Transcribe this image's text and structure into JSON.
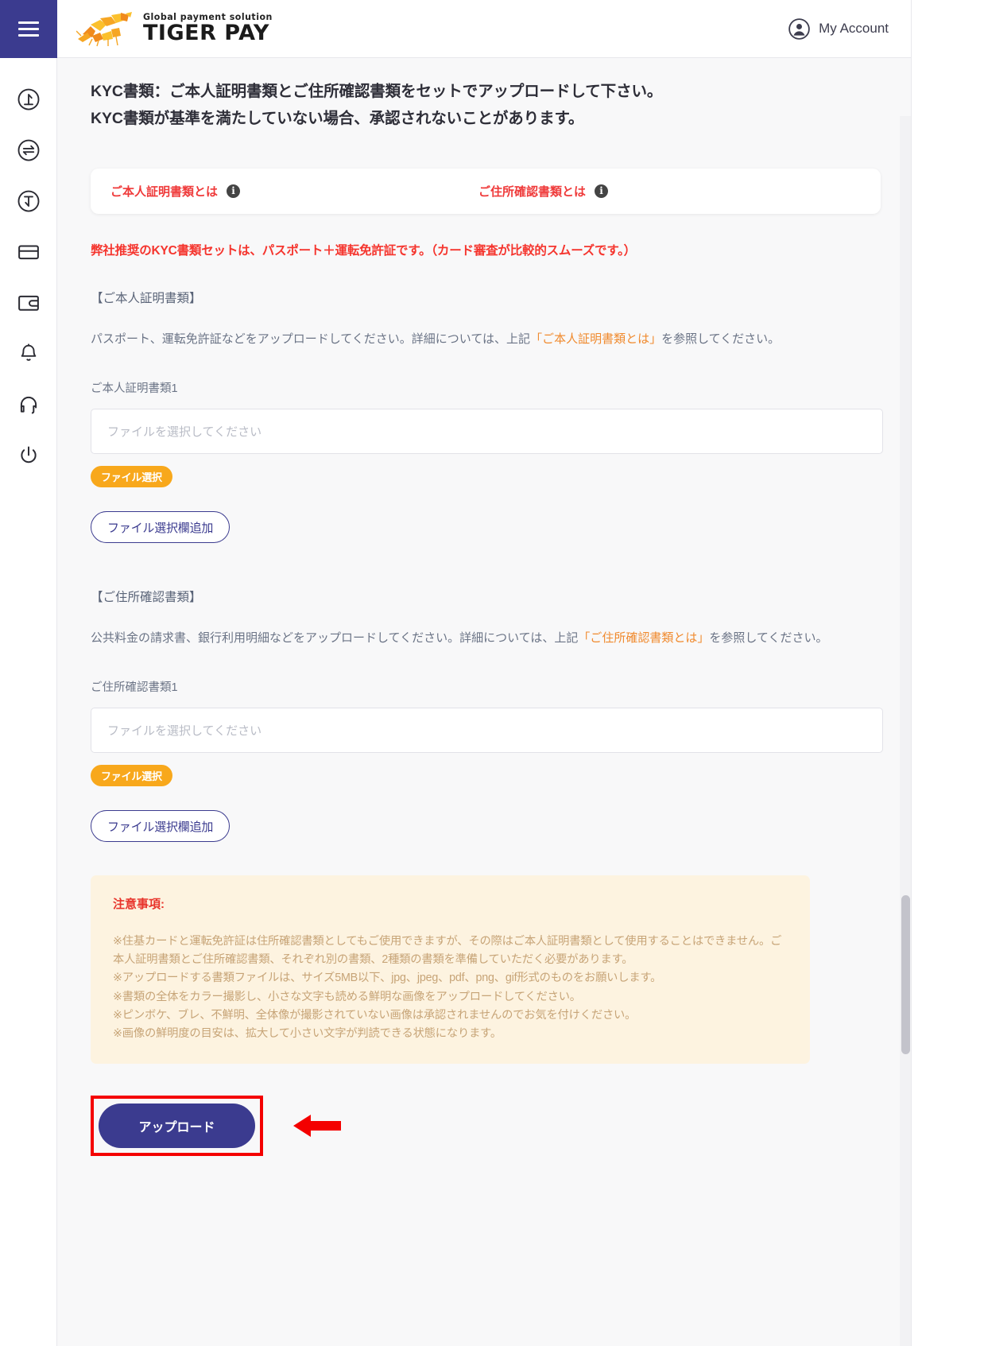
{
  "header": {
    "menu_icon": "hamburger-icon",
    "logo_sub": "Global payment solution",
    "logo_main": "TIGER PAY",
    "account_label": "My Account",
    "account_icon": "user-circle-icon"
  },
  "sidebar": {
    "items": [
      {
        "name": "deposit",
        "icon": "arrow-up-circle-icon"
      },
      {
        "name": "transfer",
        "icon": "exchange-circle-icon"
      },
      {
        "name": "withdraw",
        "icon": "arrow-down-circle-icon"
      },
      {
        "name": "card",
        "icon": "credit-card-icon"
      },
      {
        "name": "wallet",
        "icon": "wallet-icon"
      },
      {
        "name": "notifications",
        "icon": "bell-icon"
      },
      {
        "name": "support",
        "icon": "headset-icon"
      },
      {
        "name": "logout",
        "icon": "power-icon"
      }
    ]
  },
  "main": {
    "title_line1": "KYC書類：ご本人証明書類とご住所確認書類をセットでアップロードして下さい。",
    "title_line2": "KYC書類が基準を満たしていない場合、承認されないことがあります。",
    "info_card": {
      "link1": "ご本人証明書類とは",
      "link2": "ご住所確認書類とは",
      "info_glyph": "i"
    },
    "recommend": "弊社推奨のKYC書類セットは、パスポート＋運転免許証です。（カード審査が比較的スムーズです。）",
    "identity": {
      "heading": "【ご本人証明書類】",
      "desc_before": "パスポート、運転免許証などをアップロードしてください。詳細については、上記",
      "desc_link": "「ご本人証明書類とは」",
      "desc_after": "を参照してください。",
      "field_label": "ご本人証明書類1",
      "input_placeholder": "ファイルを選択してください",
      "input_value": "",
      "select_button": "ファイル選択",
      "add_button": "ファイル選択欄追加"
    },
    "address": {
      "heading": "【ご住所確認書類】",
      "desc_before": "公共料金の請求書、銀行利用明細などをアップロードしてください。詳細については、上記",
      "desc_link": "「ご住所確認書類とは」",
      "desc_after": "を参照してください。",
      "field_label": "ご住所確認書類1",
      "input_placeholder": "ファイルを選択してください",
      "input_value": "",
      "select_button": "ファイル選択",
      "add_button": "ファイル選択欄追加"
    },
    "notice": {
      "title": "注意事項:",
      "lines": [
        "※住基カードと運転免許証は住所確認書類としてもご使用できますが、その際はご本人証明書類として使用することはできません。ご本人証明書類とご住所確認書類、それぞれ別の書類、2種類の書類を準備していただく必要があります。",
        "※アップロードする書類ファイルは、サイズ5MB以下、jpg、jpeg、pdf、png、gif形式のものをお願いします。",
        "※書類の全体をカラー撮影し、小さな文字も読める鮮明な画像をアップロードしてください。",
        "※ピンボケ、ブレ、不鮮明、全体像が撮影されていない画像は承認されませんのでお気を付けください。",
        "※画像の鮮明度の目安は、拡大して小さい文字が判読できる状態になります。"
      ]
    },
    "upload_button": "アップロード",
    "annotation_arrow": "red-left-arrow"
  },
  "colors": {
    "brand_purple": "#3b3b8f",
    "accent_orange": "#f8a81c",
    "alert_red": "#ef3a3a",
    "notice_bg": "#fdf3e0",
    "highlight_red": "#f40000"
  }
}
